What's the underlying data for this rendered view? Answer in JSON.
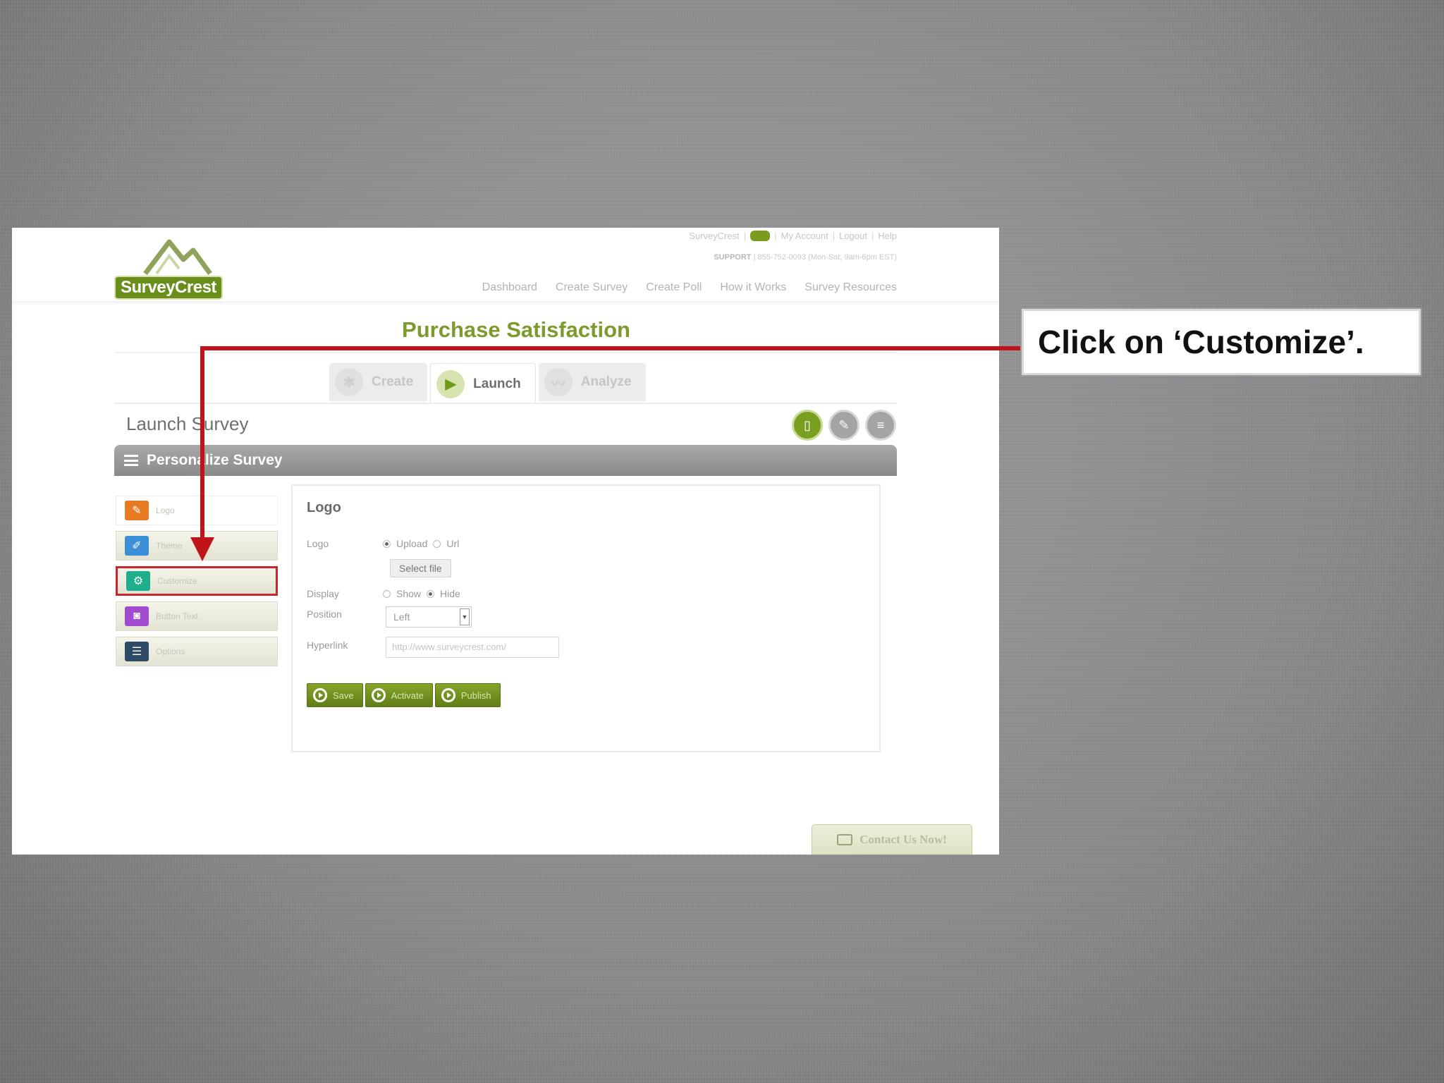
{
  "header": {
    "top_links": [
      "SurveyCrest",
      "My Account",
      "Logout",
      "Help"
    ],
    "support_label": "SUPPORT",
    "support_text": "| 855-752-0093 (Mon-Sat, 9am-6pm EST)",
    "logo_text": "SurveyCrest",
    "nav": [
      "Dashboard",
      "Create Survey",
      "Create Poll",
      "How it Works",
      "Survey Resources"
    ]
  },
  "survey": {
    "title": "Purchase Satisfaction",
    "tabs": [
      {
        "label": "Create",
        "active": false
      },
      {
        "label": "Launch",
        "active": true
      },
      {
        "label": "Analyze",
        "active": false
      }
    ]
  },
  "launch": {
    "heading": "Launch Survey",
    "section_title": "Personalize Survey"
  },
  "side_menu": [
    {
      "label": "Logo",
      "icon": "logo-edit-icon",
      "color": "#e87b22"
    },
    {
      "label": "Theme",
      "icon": "theme-icon",
      "color": "#3a8fd6"
    },
    {
      "label": "Customize",
      "icon": "customize-icon",
      "color": "#1fae8c"
    },
    {
      "label": "Button Text",
      "icon": "button-text-icon",
      "color": "#a24bd0"
    },
    {
      "label": "Options",
      "icon": "options-icon",
      "color": "#2f4a66"
    }
  ],
  "logo_panel": {
    "title": "Logo",
    "logo_label": "Logo",
    "upload_label": "Upload",
    "url_label": "Url",
    "select_file_label": "Select file",
    "display_label": "Display",
    "show_label": "Show",
    "hide_label": "Hide",
    "position_label": "Position",
    "position_value": "Left",
    "hyperlink_label": "Hyperlink",
    "hyperlink_placeholder": "http://www.surveycrest.com/",
    "buttons": [
      "Save",
      "Activate",
      "Publish"
    ]
  },
  "contact_button": "Contact Us Now!",
  "callout": {
    "text": "Click on ‘Customize’.",
    "arrow_color": "#c0141b"
  }
}
